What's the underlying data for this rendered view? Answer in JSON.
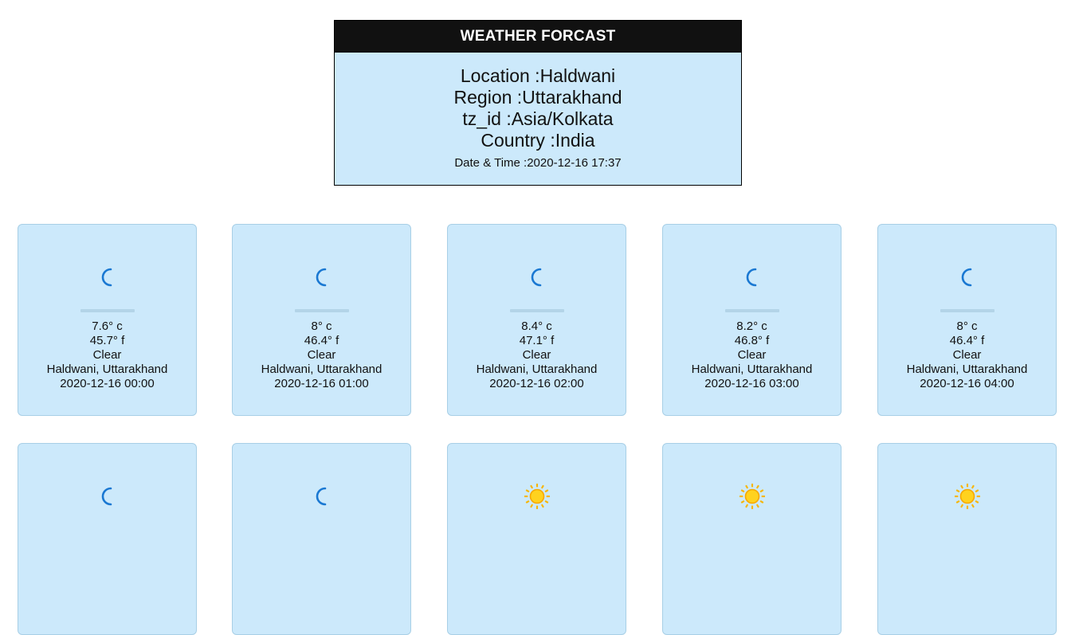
{
  "header": {
    "title": "WEATHER FORCAST",
    "location": "Location :Haldwani",
    "region": "Region :Uttarakhand",
    "tz": "tz_id :Asia/Kolkata",
    "country": "Country :India",
    "datetime": "Date & Time :2020-12-16 17:37"
  },
  "cards": [
    {
      "icon": "moon-icon",
      "temp_c": "7.6° c",
      "temp_f": "45.7° f",
      "condition": "Clear",
      "place": "Haldwani, Uttarakhand",
      "time": "2020-12-16 00:00"
    },
    {
      "icon": "moon-icon",
      "temp_c": "8° c",
      "temp_f": "46.4° f",
      "condition": "Clear",
      "place": "Haldwani, Uttarakhand",
      "time": "2020-12-16 01:00"
    },
    {
      "icon": "moon-icon",
      "temp_c": "8.4° c",
      "temp_f": "47.1° f",
      "condition": "Clear",
      "place": "Haldwani, Uttarakhand",
      "time": "2020-12-16 02:00"
    },
    {
      "icon": "moon-icon",
      "temp_c": "8.2° c",
      "temp_f": "46.8° f",
      "condition": "Clear",
      "place": "Haldwani, Uttarakhand",
      "time": "2020-12-16 03:00"
    },
    {
      "icon": "moon-icon",
      "temp_c": "8° c",
      "temp_f": "46.4° f",
      "condition": "Clear",
      "place": "Haldwani, Uttarakhand",
      "time": "2020-12-16 04:00"
    },
    {
      "icon": "moon-icon"
    },
    {
      "icon": "moon-icon"
    },
    {
      "icon": "sun-icon"
    },
    {
      "icon": "sun-icon"
    },
    {
      "icon": "sun-icon"
    }
  ],
  "colors": {
    "panel": "#cce9fb",
    "header_bar": "#111111",
    "moon": "#1a78d2",
    "sun": "#f7b500"
  }
}
